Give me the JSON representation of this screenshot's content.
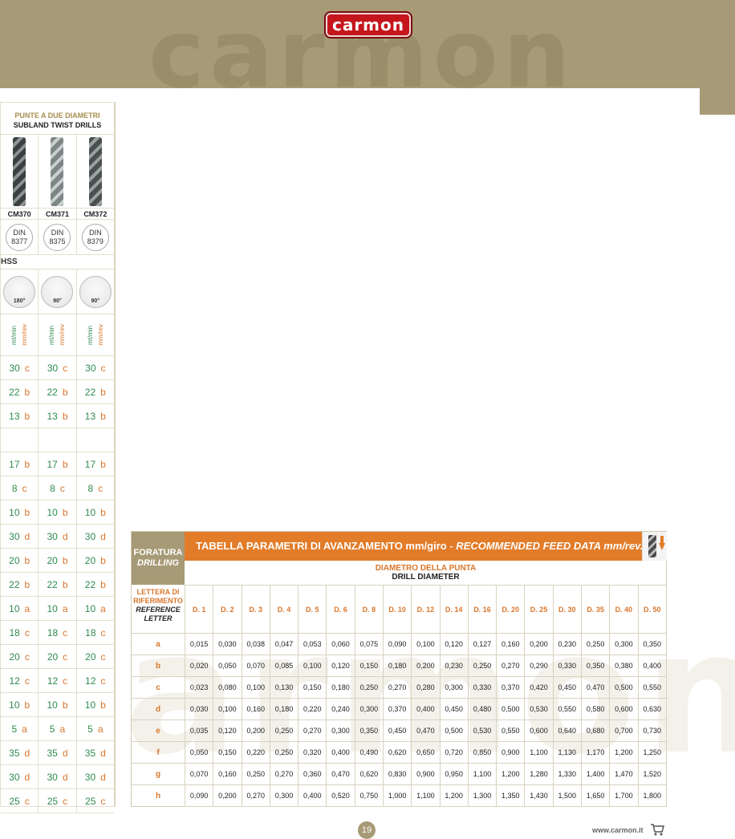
{
  "header": {
    "logo_text": "carmon",
    "watermark_text": "carmon"
  },
  "left_column": {
    "title_line1": "PUNTE A DUE DIAMETRI",
    "title_line2": "SUBLAND TWIST DRILLS",
    "codes": [
      "CM370",
      "CM371",
      "CM372"
    ],
    "din": [
      {
        "l1": "DIN",
        "l2": "8377"
      },
      {
        "l1": "DIN",
        "l2": "8375"
      },
      {
        "l1": "DIN",
        "l2": "8379"
      }
    ],
    "material": "HSS",
    "angles": [
      "180°",
      "90°",
      "90°"
    ],
    "unit_speed": "mt/min",
    "unit_feed": "mm/rev",
    "rows": [
      {
        "v": "30",
        "l": "c"
      },
      {
        "v": "22",
        "l": "b"
      },
      {
        "v": "13",
        "l": "b"
      },
      {
        "v": "",
        "l": ""
      },
      {
        "v": "17",
        "l": "b"
      },
      {
        "v": "8",
        "l": "c"
      },
      {
        "v": "10",
        "l": "b"
      },
      {
        "v": "30",
        "l": "d"
      },
      {
        "v": "20",
        "l": "b"
      },
      {
        "v": "22",
        "l": "b"
      },
      {
        "v": "10",
        "l": "a"
      },
      {
        "v": "18",
        "l": "c"
      },
      {
        "v": "20",
        "l": "c"
      },
      {
        "v": "12",
        "l": "c"
      },
      {
        "v": "10",
        "l": "b"
      },
      {
        "v": "5",
        "l": "a"
      },
      {
        "v": "35",
        "l": "d"
      },
      {
        "v": "30",
        "l": "d"
      },
      {
        "v": "25",
        "l": "c"
      }
    ]
  },
  "feed_table": {
    "label_line1": "FORATURA",
    "label_line2": "DRILLING",
    "title_it": "TABELLA PARAMETRI DI AVANZAMENTO mm/giro",
    "title_sep": " - ",
    "title_en": "RECOMMENDED FEED DATA mm/rev.",
    "diam_it": "DIAMETRO DELLA PUNTA",
    "diam_en": "DRILL DIAMETER",
    "ref_it_1": "LETTERA DI",
    "ref_it_2": "RIFERIMENTO",
    "ref_en_1": "REFERENCE",
    "ref_en_2": "LETTER",
    "columns": [
      "D. 1",
      "D. 2",
      "D. 3",
      "D. 4",
      "D. 5",
      "D. 6",
      "D. 8",
      "D. 10",
      "D. 12",
      "D. 14",
      "D. 16",
      "D. 20",
      "D. 25",
      "D. 30",
      "D. 35",
      "D. 40",
      "D. 50"
    ],
    "rows": [
      {
        "letter": "a",
        "values": [
          "0,015",
          "0,030",
          "0,038",
          "0,047",
          "0,053",
          "0,060",
          "0,075",
          "0,090",
          "0,100",
          "0,120",
          "0,127",
          "0,160",
          "0,200",
          "0,230",
          "0,250",
          "0,300",
          "0,350"
        ]
      },
      {
        "letter": "b",
        "values": [
          "0,020",
          "0,050",
          "0,070",
          "0,085",
          "0,100",
          "0,120",
          "0,150",
          "0,180",
          "0,200",
          "0,230",
          "0,250",
          "0,270",
          "0,290",
          "0,330",
          "0,350",
          "0,380",
          "0,400"
        ]
      },
      {
        "letter": "c",
        "values": [
          "0,023",
          "0,080",
          "0,100",
          "0,130",
          "0,150",
          "0,180",
          "0,250",
          "0,270",
          "0,280",
          "0,300",
          "0,330",
          "0,370",
          "0,420",
          "0,450",
          "0,470",
          "0,500",
          "0,550"
        ]
      },
      {
        "letter": "d",
        "values": [
          "0,030",
          "0,100",
          "0,160",
          "0,180",
          "0,220",
          "0,240",
          "0,300",
          "0,370",
          "0,400",
          "0,450",
          "0,480",
          "0,500",
          "0,530",
          "0,550",
          "0,580",
          "0,600",
          "0,630"
        ]
      },
      {
        "letter": "e",
        "values": [
          "0,035",
          "0,120",
          "0,200",
          "0,250",
          "0,270",
          "0,300",
          "0,350",
          "0,450",
          "0,470",
          "0,500",
          "0,530",
          "0,550",
          "0,600",
          "0,640",
          "0,680",
          "0,700",
          "0,730"
        ]
      },
      {
        "letter": "f",
        "values": [
          "0,050",
          "0,150",
          "0,220",
          "0,250",
          "0,320",
          "0,400",
          "0,490",
          "0,620",
          "0,650",
          "0,720",
          "0,850",
          "0,900",
          "1,100",
          "1,130",
          "1,170",
          "1,200",
          "1,250"
        ]
      },
      {
        "letter": "g",
        "values": [
          "0,070",
          "0,160",
          "0,250",
          "0,270",
          "0,360",
          "0,470",
          "0,620",
          "0,830",
          "0,900",
          "0,950",
          "1,100",
          "1,200",
          "1,280",
          "1,330",
          "1,400",
          "1,470",
          "1,520"
        ]
      },
      {
        "letter": "h",
        "values": [
          "0,090",
          "0,200",
          "0,270",
          "0,300",
          "0,400",
          "0,520",
          "0,750",
          "1,000",
          "1,100",
          "1,200",
          "1,300",
          "1,350",
          "1,430",
          "1,500",
          "1,650",
          "1,700",
          "1,800"
        ]
      }
    ]
  },
  "footer": {
    "page_number": "19",
    "website": "www.carmon.it",
    "cart_icon": "cart-icon"
  }
}
